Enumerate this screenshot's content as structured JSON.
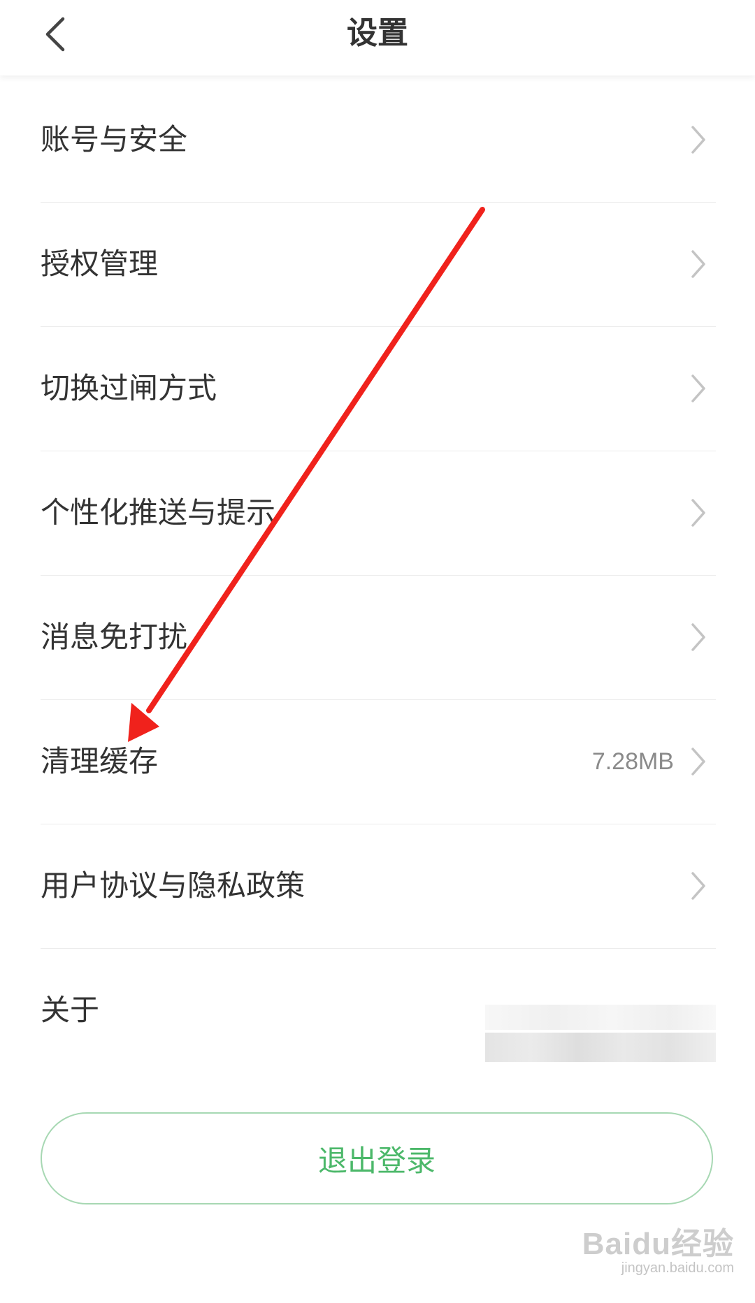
{
  "header": {
    "title": "设置",
    "back_icon": "chevron-left-icon"
  },
  "settings": {
    "items": [
      {
        "label": "账号与安全",
        "value": "",
        "icon": "chevron-right-icon"
      },
      {
        "label": "授权管理",
        "value": "",
        "icon": "chevron-right-icon"
      },
      {
        "label": "切换过闸方式",
        "value": "",
        "icon": "chevron-right-icon"
      },
      {
        "label": "个性化推送与提示",
        "value": "",
        "icon": "chevron-right-icon"
      },
      {
        "label": "消息免打扰",
        "value": "",
        "icon": "chevron-right-icon"
      },
      {
        "label": "清理缓存",
        "value": "7.28MB",
        "icon": "chevron-right-icon"
      },
      {
        "label": "用户协议与隐私政策",
        "value": "",
        "icon": "chevron-right-icon"
      },
      {
        "label": "关于",
        "value": "",
        "icon": ""
      }
    ]
  },
  "logout": {
    "label": "退出登录"
  },
  "watermark": {
    "logo": "Baidu经验",
    "url": "jingyan.baidu.com"
  },
  "colors": {
    "accent_green": "#4cb86a",
    "button_border": "#a7d8b3",
    "annotation_red": "#f0221c",
    "chevron_gray": "#c4c4c4",
    "value_gray": "#8a8a8a"
  }
}
